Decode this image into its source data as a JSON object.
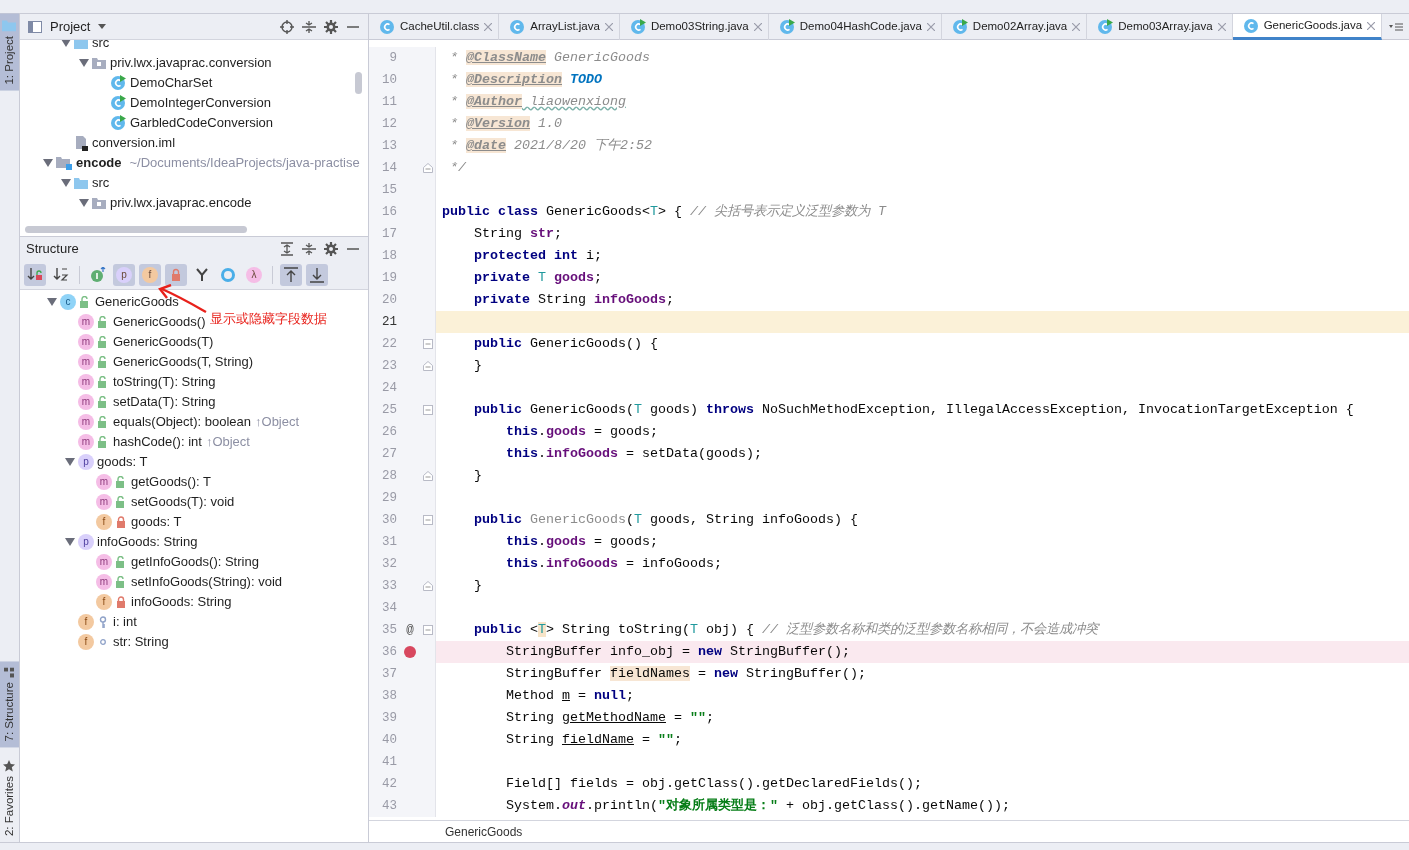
{
  "side_tabs": {
    "top": [
      {
        "label": "1: Project",
        "selected": true,
        "kind": "folder"
      }
    ],
    "bottom": [
      {
        "label": "7: Structure",
        "selected": true,
        "kind": "structure"
      },
      {
        "label": "2: Favorites",
        "selected": false,
        "kind": "star"
      }
    ]
  },
  "project": {
    "title": "Project",
    "tree": [
      {
        "children": [
          {
            "label": "src",
            "kind": "folder",
            "expanded": true,
            "children": [
              {
                "label": "priv.lwx.javaprac.conversion",
                "kind": "package",
                "expanded": true,
                "children": [
                  {
                    "label": "DemoCharSet",
                    "kind": "class"
                  },
                  {
                    "label": "DemoIntegerConversion",
                    "kind": "class"
                  },
                  {
                    "label": "GarbledCodeConversion",
                    "kind": "class"
                  }
                ]
              }
            ]
          },
          {
            "label": "conversion.iml",
            "kind": "file"
          }
        ]
      },
      {
        "label": "encode",
        "path": "~/Documents/IdeaProjects/java-practise",
        "kind": "module",
        "expanded": true,
        "children": [
          {
            "label": "src",
            "kind": "folder",
            "expanded": true,
            "children": [
              {
                "label": "priv.lwx.javaprac.encode",
                "kind": "package",
                "expanded": true
              }
            ]
          }
        ]
      }
    ]
  },
  "structure": {
    "title": "Structure",
    "toolbar": [
      {
        "kind": "visibility",
        "pressed": true
      },
      {
        "kind": "alpha",
        "pressed": false
      },
      {
        "kind": "sep"
      },
      {
        "kind": "inherited",
        "pressed": false
      },
      {
        "kind": "badge",
        "badge": "p",
        "color": "#d9d0fb",
        "pressed": true
      },
      {
        "kind": "badge",
        "badge": "f",
        "color": "#f3c9a0",
        "pressed": true
      },
      {
        "kind": "lock",
        "pressed": true
      },
      {
        "kind": "fork",
        "pressed": false
      },
      {
        "kind": "ring",
        "pressed": false
      },
      {
        "kind": "badge",
        "badge": "λ",
        "color": "#f5bde6",
        "pressed": false
      },
      {
        "kind": "sep"
      },
      {
        "kind": "scroll-from",
        "pressed": true
      },
      {
        "kind": "scroll-to",
        "pressed": true
      }
    ],
    "tree": [
      {
        "badge": "c",
        "kind": "class",
        "access": {
          "kind": "public"
        },
        "label": "GenericGoods",
        "expanded": true,
        "children": [
          {
            "badge": "m",
            "kind": "method",
            "access": {
              "kind": "public"
            },
            "label": "GenericGoods()"
          },
          {
            "badge": "m",
            "kind": "method",
            "access": {
              "kind": "public"
            },
            "label": "GenericGoods(T)"
          },
          {
            "badge": "m",
            "kind": "method",
            "access": {
              "kind": "public"
            },
            "label": "GenericGoods(T, String)"
          },
          {
            "badge": "m",
            "kind": "method",
            "access": {
              "kind": "public"
            },
            "label": "toString(T): String"
          },
          {
            "badge": "m",
            "kind": "method",
            "access": {
              "kind": "public"
            },
            "label": "setData(T): String"
          },
          {
            "badge": "m",
            "kind": "method",
            "access": {
              "kind": "public"
            },
            "label": "equals(Object): boolean",
            "suffix": "↑Object"
          },
          {
            "badge": "m",
            "kind": "method",
            "access": {
              "kind": "public"
            },
            "label": "hashCode(): int",
            "suffix": "↑Object"
          },
          {
            "badge": "p",
            "kind": "property",
            "label": "goods: T",
            "expanded": true,
            "children": [
              {
                "badge": "m",
                "kind": "method",
                "access": {
                  "kind": "public"
                },
                "label": "getGoods(): T"
              },
              {
                "badge": "m",
                "kind": "method",
                "access": {
                  "kind": "public"
                },
                "label": "setGoods(T): void"
              },
              {
                "badge": "f",
                "kind": "field",
                "access": {
                  "kind": "private"
                },
                "label": "goods: T"
              }
            ]
          },
          {
            "badge": "p",
            "kind": "property",
            "label": "infoGoods: String",
            "expanded": true,
            "children": [
              {
                "badge": "m",
                "kind": "method",
                "access": {
                  "kind": "public"
                },
                "label": "getInfoGoods(): String"
              },
              {
                "badge": "m",
                "kind": "method",
                "access": {
                  "kind": "public"
                },
                "label": "setInfoGoods(String): void"
              },
              {
                "badge": "f",
                "kind": "field",
                "access": {
                  "kind": "private"
                },
                "label": "infoGoods: String"
              }
            ]
          },
          {
            "badge": "f",
            "kind": "field",
            "access": {
              "kind": "protected"
            },
            "label": "i: int"
          },
          {
            "badge": "f",
            "kind": "field",
            "access": {
              "kind": "package"
            },
            "label": "str: String"
          }
        ]
      }
    ]
  },
  "annotation": {
    "text": "显示或隐藏字段数据"
  },
  "editor": {
    "tabs": [
      {
        "label": "CacheUtil.class",
        "selected": false,
        "runnable": false
      },
      {
        "label": "ArrayList.java",
        "selected": false,
        "runnable": false
      },
      {
        "label": "Demo03String.java",
        "selected": false,
        "runnable": true
      },
      {
        "label": "Demo04HashCode.java",
        "selected": false,
        "runnable": true
      },
      {
        "label": "Demo02Array.java",
        "selected": false,
        "runnable": true
      },
      {
        "label": "Demo03Array.java",
        "selected": false,
        "runnable": true
      },
      {
        "label": "GenericGoods.java",
        "selected": true,
        "runnable": false
      }
    ],
    "lines": [
      {
        "n": "9",
        "current": false,
        "breakpoint": false,
        "tokens": [
          {
            "kind": "doc",
            "text": " * "
          },
          {
            "kind": "doctag",
            "text": "@ClassName"
          },
          {
            "kind": "doc",
            "text": " GenericGoods"
          }
        ]
      },
      {
        "n": "10",
        "current": false,
        "breakpoint": false,
        "tokens": [
          {
            "kind": "doc",
            "text": " * "
          },
          {
            "kind": "doctag",
            "text": "@Description"
          },
          {
            "kind": "todo",
            "text": " TODO"
          }
        ]
      },
      {
        "n": "11",
        "current": false,
        "breakpoint": false,
        "tokens": [
          {
            "kind": "doc",
            "text": " * "
          },
          {
            "kind": "doctag",
            "text": "@Author"
          },
          {
            "kind": "docword",
            "text": " liaowenxiong"
          }
        ]
      },
      {
        "n": "12",
        "current": false,
        "breakpoint": false,
        "tokens": [
          {
            "kind": "doc",
            "text": " * "
          },
          {
            "kind": "doctag",
            "text": "@Version"
          },
          {
            "kind": "doc",
            "text": " 1.0"
          }
        ]
      },
      {
        "n": "13",
        "current": false,
        "breakpoint": false,
        "tokens": [
          {
            "kind": "doc",
            "text": " * "
          },
          {
            "kind": "doctag",
            "text": "@date"
          },
          {
            "kind": "doc",
            "text": " 2021/8/20 下午2:52"
          }
        ]
      },
      {
        "n": "14",
        "current": false,
        "breakpoint": false,
        "fold": {
          "kind": "end"
        },
        "tokens": [
          {
            "kind": "doc",
            "text": " */"
          }
        ]
      },
      {
        "n": "15",
        "current": false,
        "breakpoint": false
      },
      {
        "n": "16",
        "current": false,
        "breakpoint": false,
        "tokens": [
          {
            "kind": "keyword",
            "text": "public class "
          },
          {
            "kind": "plain",
            "text": "GenericGoods<"
          },
          {
            "kind": "typeparam",
            "text": "T"
          },
          {
            "kind": "plain",
            "text": "> { "
          },
          {
            "kind": "comment",
            "text": "// 尖括号表示定义泛型参数为 T"
          }
        ]
      },
      {
        "n": "17",
        "current": false,
        "breakpoint": false,
        "tokens": [
          {
            "kind": "plain",
            "text": "    String "
          },
          {
            "kind": "field",
            "text": "str"
          },
          {
            "kind": "plain",
            "text": ";"
          }
        ]
      },
      {
        "n": "18",
        "current": false,
        "breakpoint": false,
        "tokens": [
          {
            "kind": "keyword",
            "text": "    protected int "
          },
          {
            "kind": "plain",
            "text": "i;"
          }
        ]
      },
      {
        "n": "19",
        "current": false,
        "breakpoint": false,
        "tokens": [
          {
            "kind": "keyword",
            "text": "    private "
          },
          {
            "kind": "typeparam",
            "text": "T "
          },
          {
            "kind": "field",
            "text": "goods"
          },
          {
            "kind": "plain",
            "text": ";"
          }
        ]
      },
      {
        "n": "20",
        "current": false,
        "breakpoint": false,
        "tokens": [
          {
            "kind": "keyword",
            "text": "    private "
          },
          {
            "kind": "plain",
            "text": "String "
          },
          {
            "kind": "field",
            "text": "infoGoods"
          },
          {
            "kind": "plain",
            "text": ";"
          }
        ]
      },
      {
        "n": "21",
        "current": true,
        "breakpoint": false
      },
      {
        "n": "22",
        "current": false,
        "breakpoint": false,
        "fold": {
          "kind": "start"
        },
        "tokens": [
          {
            "kind": "keyword",
            "text": "    public "
          },
          {
            "kind": "plain",
            "text": "GenericGoods() {"
          }
        ]
      },
      {
        "n": "23",
        "current": false,
        "breakpoint": false,
        "fold": {
          "kind": "end"
        },
        "tokens": [
          {
            "kind": "plain",
            "text": "    }"
          }
        ]
      },
      {
        "n": "24",
        "current": false,
        "breakpoint": false
      },
      {
        "n": "25",
        "current": false,
        "breakpoint": false,
        "fold": {
          "kind": "start"
        },
        "tokens": [
          {
            "kind": "keyword",
            "text": "    public "
          },
          {
            "kind": "plain",
            "text": "GenericGoods("
          },
          {
            "kind": "typeparam",
            "text": "T"
          },
          {
            "kind": "plain",
            "text": " goods) "
          },
          {
            "kind": "keyword",
            "text": "throws "
          },
          {
            "kind": "plain",
            "text": "NoSuchMethodException, IllegalAccessException, InvocationTargetException {"
          }
        ]
      },
      {
        "n": "26",
        "current": false,
        "breakpoint": false,
        "tokens": [
          {
            "kind": "keyword",
            "text": "        this"
          },
          {
            "kind": "plain",
            "text": "."
          },
          {
            "kind": "field",
            "text": "goods"
          },
          {
            "kind": "plain",
            "text": " = goods;"
          }
        ]
      },
      {
        "n": "27",
        "current": false,
        "breakpoint": false,
        "tokens": [
          {
            "kind": "keyword",
            "text": "        this"
          },
          {
            "kind": "plain",
            "text": "."
          },
          {
            "kind": "field",
            "text": "infoGoods"
          },
          {
            "kind": "plain",
            "text": " = setData(goods);"
          }
        ]
      },
      {
        "n": "28",
        "current": false,
        "breakpoint": false,
        "fold": {
          "kind": "end"
        },
        "tokens": [
          {
            "kind": "plain",
            "text": "    }"
          }
        ]
      },
      {
        "n": "29",
        "current": false,
        "breakpoint": false
      },
      {
        "n": "30",
        "current": false,
        "breakpoint": false,
        "fold": {
          "kind": "start"
        },
        "tokens": [
          {
            "kind": "keyword",
            "text": "    public "
          },
          {
            "kind": "unused",
            "text": "GenericGoods"
          },
          {
            "kind": "plain",
            "text": "("
          },
          {
            "kind": "typeparam",
            "text": "T"
          },
          {
            "kind": "plain",
            "text": " goods, String infoGoods) {"
          }
        ]
      },
      {
        "n": "31",
        "current": false,
        "breakpoint": false,
        "tokens": [
          {
            "kind": "keyword",
            "text": "        this"
          },
          {
            "kind": "plain",
            "text": "."
          },
          {
            "kind": "field",
            "text": "goods"
          },
          {
            "kind": "plain",
            "text": " = goods;"
          }
        ]
      },
      {
        "n": "32",
        "current": false,
        "breakpoint": false,
        "tokens": [
          {
            "kind": "keyword",
            "text": "        this"
          },
          {
            "kind": "plain",
            "text": "."
          },
          {
            "kind": "field",
            "text": "infoGoods"
          },
          {
            "kind": "plain",
            "text": " = infoGoods;"
          }
        ]
      },
      {
        "n": "33",
        "current": false,
        "breakpoint": false,
        "fold": {
          "kind": "end"
        },
        "tokens": [
          {
            "kind": "plain",
            "text": "    }"
          }
        ]
      },
      {
        "n": "34",
        "current": false,
        "breakpoint": false
      },
      {
        "n": "35",
        "current": false,
        "breakpoint": false,
        "fold": {
          "kind": "start"
        },
        "mark": "@",
        "tokens": [
          {
            "kind": "keyword",
            "text": "    public "
          },
          {
            "kind": "plain",
            "text": "<"
          },
          {
            "kind": "typehl",
            "text": "T"
          },
          {
            "kind": "plain",
            "text": "> String toString("
          },
          {
            "kind": "typeparam",
            "text": "T"
          },
          {
            "kind": "plain",
            "text": " obj) { "
          },
          {
            "kind": "comment",
            "text": "// 泛型参数名称和类的泛型参数名称相同，不会造成冲突"
          }
        ]
      },
      {
        "n": "36",
        "current": false,
        "breakpoint": true,
        "tokens": [
          {
            "kind": "plain",
            "text": "        StringBuffer info_obj = "
          },
          {
            "kind": "keyword",
            "text": "new "
          },
          {
            "kind": "plain",
            "text": "StringBuffer();"
          }
        ]
      },
      {
        "n": "37",
        "current": false,
        "breakpoint": false,
        "tokens": [
          {
            "kind": "plain",
            "text": "        StringBuffer "
          },
          {
            "kind": "highlight",
            "text": "fieldNames"
          },
          {
            "kind": "plain",
            "text": " = "
          },
          {
            "kind": "keyword",
            "text": "new "
          },
          {
            "kind": "plain",
            "text": "StringBuffer();"
          }
        ]
      },
      {
        "n": "38",
        "current": false,
        "breakpoint": false,
        "tokens": [
          {
            "kind": "plain",
            "text": "        Method "
          },
          {
            "kind": "reassigned",
            "text": "m"
          },
          {
            "kind": "plain",
            "text": " = "
          },
          {
            "kind": "keyword",
            "text": "null"
          },
          {
            "kind": "plain",
            "text": ";"
          }
        ]
      },
      {
        "n": "39",
        "current": false,
        "breakpoint": false,
        "tokens": [
          {
            "kind": "plain",
            "text": "        String "
          },
          {
            "kind": "reassigned",
            "text": "getMethodName"
          },
          {
            "kind": "plain",
            "text": " = "
          },
          {
            "kind": "string",
            "text": "\"\""
          },
          {
            "kind": "plain",
            "text": ";"
          }
        ]
      },
      {
        "n": "40",
        "current": false,
        "breakpoint": false,
        "tokens": [
          {
            "kind": "plain",
            "text": "        String "
          },
          {
            "kind": "reassigned",
            "text": "fieldName"
          },
          {
            "kind": "plain",
            "text": " = "
          },
          {
            "kind": "string",
            "text": "\"\""
          },
          {
            "kind": "plain",
            "text": ";"
          }
        ]
      },
      {
        "n": "41",
        "current": false,
        "breakpoint": false
      },
      {
        "n": "42",
        "current": false,
        "breakpoint": false,
        "tokens": [
          {
            "kind": "plain",
            "text": "        Field[] fields = obj.getClass().getDeclaredFields();"
          }
        ]
      },
      {
        "n": "43",
        "current": false,
        "breakpoint": false,
        "tokens": [
          {
            "kind": "plain",
            "text": "        System."
          },
          {
            "kind": "static",
            "text": "out"
          },
          {
            "kind": "plain",
            "text": ".println("
          },
          {
            "kind": "string",
            "text": "\"对象所属类型是：\""
          },
          {
            "kind": "plain",
            "text": " + obj.getClass().getName());"
          }
        ]
      }
    ],
    "breadcrumb": "GenericGoods"
  }
}
